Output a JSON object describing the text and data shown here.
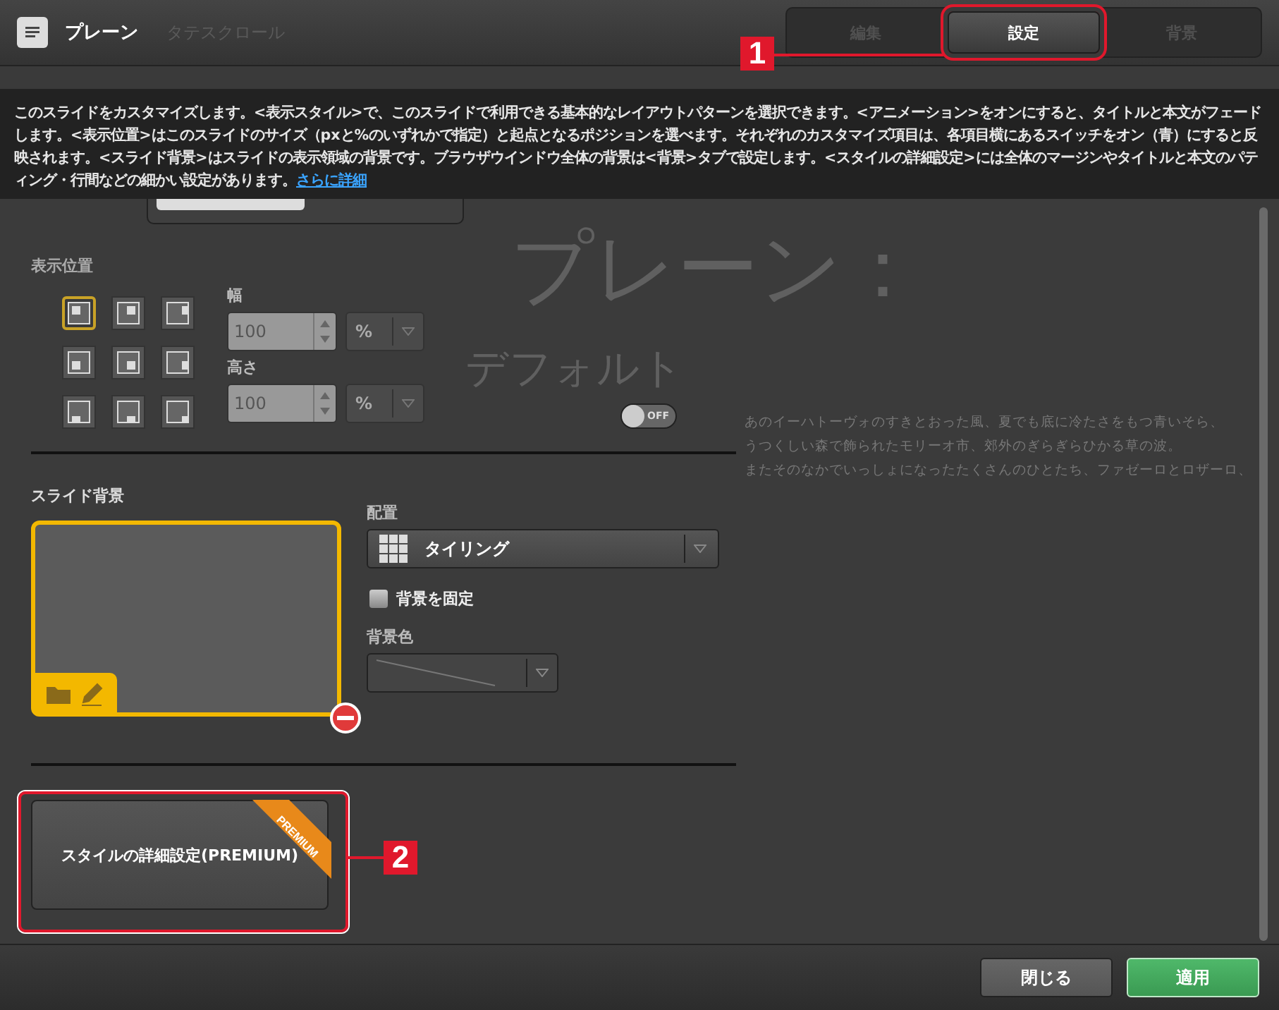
{
  "window": {
    "title": "プレーン",
    "behind_field": "タテスクロール"
  },
  "tabs": [
    {
      "label": "編集",
      "selected": false
    },
    {
      "label": "設定",
      "selected": true
    },
    {
      "label": "背景",
      "selected": false
    }
  ],
  "help": {
    "text": "このスライドをカスタマイズします。<表示スタイル>で、このスライドで利用できる基本的なレイアウトパターンを選択できます。<アニメーション>をオンにすると、タイトルと本文がフェードします。<表示位置>はこのスライドのサイズ（pxと%のいずれかで指定）と起点となるポジションを選べます。それぞれのカスタマイズ項目は、各項目横にあるスイッチをオン（青）にすると反映されます。<スライド背景>はスライドの表示領域の背景です。ブラウザウインドウ全体の背景は<背景>タブで設定します。<スタイルの詳細設定>には全体のマージンやタイトルと本文のパティング・行間などの細かい設定があります。",
    "link": "さらに詳細"
  },
  "preview": {
    "title": "プレーン：",
    "subtitle": "デフォルト",
    "lines": [
      "あのイーハトーヴォのすきとおった風、夏でも底に冷たさをもつ青いそら、",
      "うつくしい森で飾られたモリーオ市、郊外のぎらぎらひかる草の波。",
      "またそのなかでいっしょになったたくさんのひとたち、ファゼーロとロザーロ、"
    ]
  },
  "position": {
    "label": "表示位置",
    "anchors": [
      {
        "selected": true
      },
      {
        "selected": false
      },
      {
        "selected": false
      },
      {
        "selected": false
      },
      {
        "selected": false
      },
      {
        "selected": false
      },
      {
        "selected": false
      },
      {
        "selected": false
      },
      {
        "selected": false
      }
    ],
    "width": {
      "label": "幅",
      "value": "100",
      "unit": "%"
    },
    "height": {
      "label": "高さ",
      "value": "100",
      "unit": "%"
    },
    "toggle": {
      "label": "OFF",
      "on": false
    }
  },
  "slide_background": {
    "label": "スライド背景",
    "arrangement": {
      "label": "配置",
      "value": "タイリング"
    },
    "fixed": {
      "label": "背景を固定",
      "checked": false
    },
    "color": {
      "label": "背景色"
    }
  },
  "advanced_button": {
    "label": "スタイルの詳細設定(PREMIUM)",
    "ribbon": "PREMIUM"
  },
  "callouts": [
    "1",
    "2"
  ],
  "buttons": [
    {
      "label": "閉じる",
      "kind": "secondary"
    },
    {
      "label": "適用",
      "kind": "primary"
    }
  ]
}
